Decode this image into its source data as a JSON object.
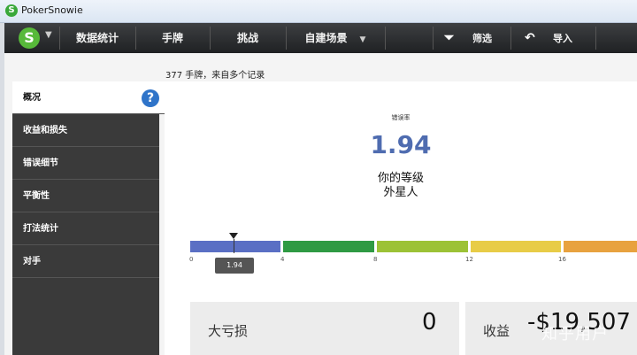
{
  "window": {
    "title": "PokerSnowie"
  },
  "menubar": {
    "logo": "S",
    "items": [
      "数据统计",
      "手牌",
      "挑战",
      "自建场景"
    ],
    "filter_label": "筛选",
    "import_label": "导入"
  },
  "subheader": "377 手牌，来自多个记录",
  "sidebar": {
    "items": [
      "概况",
      "收益和损失",
      "错误细节",
      "平衡性",
      "打法统计",
      "对手"
    ]
  },
  "main": {
    "error_rate_label": "错误率",
    "error_rate_value": "1.94",
    "level_label": "你的等级",
    "level_value": "外星人",
    "scale": {
      "ticks": [
        "0",
        "4",
        "8",
        "12",
        "16"
      ],
      "current": 1.94,
      "current_label": "1.94",
      "colors": [
        "#5a6fc4",
        "#2f9a43",
        "#9cc236",
        "#e8cc47",
        "#e8a23f"
      ]
    },
    "cards": [
      {
        "label": "大亏损",
        "value": "0"
      },
      {
        "label": "收益",
        "value": "-$19,507"
      }
    ]
  },
  "watermark": "知乎用户"
}
